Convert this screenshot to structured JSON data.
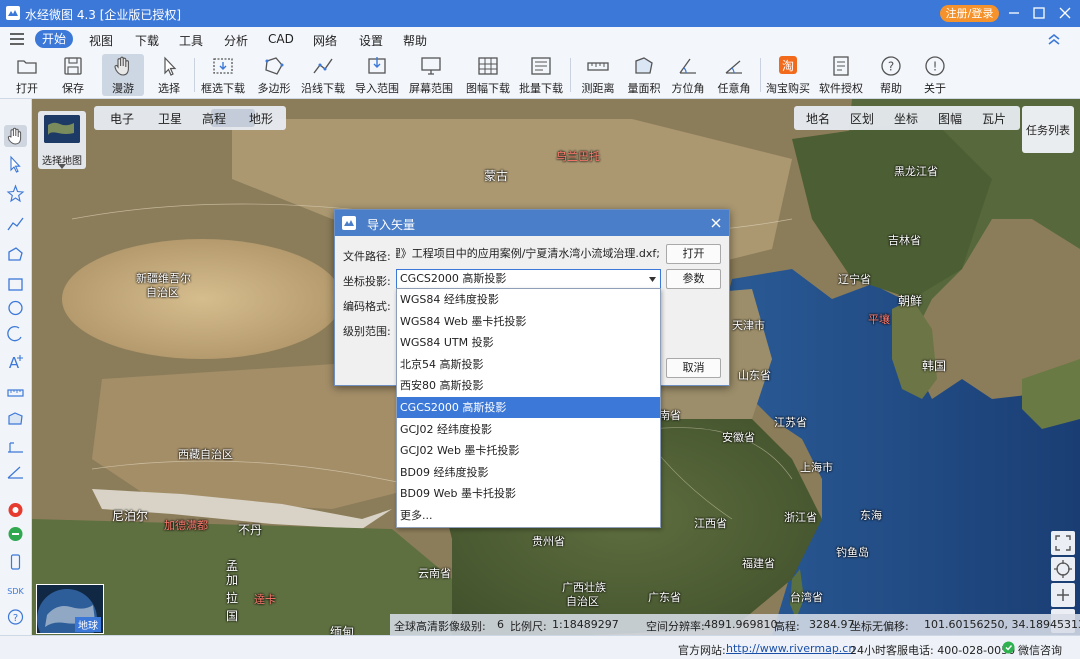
{
  "window": {
    "title": "水经微图 4.3 [企业版已授权]",
    "login_button": "注册/登录",
    "controls": [
      "minimize-icon",
      "restore-icon",
      "close-icon"
    ]
  },
  "menu": {
    "items": [
      "开始",
      "视图",
      "下载",
      "工具",
      "分析",
      "CAD",
      "网络",
      "设置",
      "帮助"
    ],
    "active": "开始"
  },
  "toolbar": {
    "items": [
      {
        "label": "打开",
        "icon": "folder-icon"
      },
      {
        "label": "保存",
        "icon": "save-icon"
      },
      {
        "label": "漫游",
        "icon": "hand-icon",
        "pressed": true
      },
      {
        "label": "选择",
        "icon": "cursor-icon"
      },
      {
        "label": "框选下载",
        "icon": "box-select-download-icon"
      },
      {
        "label": "多边形",
        "icon": "polygon-icon"
      },
      {
        "label": "沿线下载",
        "icon": "line-download-icon"
      },
      {
        "label": "导入范围",
        "icon": "import-range-icon"
      },
      {
        "label": "屏幕范围",
        "icon": "screen-range-icon"
      },
      {
        "label": "图幅下载",
        "icon": "sheet-download-icon"
      },
      {
        "label": "批量下载",
        "icon": "batch-download-icon"
      },
      {
        "label": "测距离",
        "icon": "ruler-icon"
      },
      {
        "label": "量面积",
        "icon": "area-icon"
      },
      {
        "label": "方位角",
        "icon": "azimuth-icon"
      },
      {
        "label": "任意角",
        "icon": "angle-icon"
      },
      {
        "label": "淘宝购买",
        "icon": "taobao-icon"
      },
      {
        "label": "软件授权",
        "icon": "license-icon"
      },
      {
        "label": "帮助",
        "icon": "help-icon"
      },
      {
        "label": "关于",
        "icon": "info-icon"
      }
    ]
  },
  "map": {
    "basemap_switch_label": "选择地图",
    "map_types": [
      "电子",
      "卫星",
      "高程",
      "地形"
    ],
    "active_map_type": "卫星",
    "overlays": [
      "地名",
      "区划",
      "坐标",
      "图幅",
      "瓦片"
    ],
    "task_list_label": "任务列表",
    "minimap_label": "地球",
    "labels": [
      {
        "text": "蒙古",
        "red": false
      },
      {
        "text": "乌兰巴托",
        "red": true
      },
      {
        "text": "黑龙江省",
        "red": false
      },
      {
        "text": "吉林省",
        "red": false
      },
      {
        "text": "辽宁省",
        "red": false
      },
      {
        "text": "朝鲜",
        "red": false
      },
      {
        "text": "平壤",
        "red": true
      },
      {
        "text": "韩国",
        "red": false
      },
      {
        "text": "新疆维吾尔",
        "red": false
      },
      {
        "text": "自治区",
        "red": false
      },
      {
        "text": "天津市",
        "red": false
      },
      {
        "text": "山东省",
        "red": false
      },
      {
        "text": "河南省",
        "red": false
      },
      {
        "text": "江苏省",
        "red": false
      },
      {
        "text": "安徽省",
        "red": false
      },
      {
        "text": "上海市",
        "red": false
      },
      {
        "text": "西藏自治区",
        "red": false
      },
      {
        "text": "尼泊尔",
        "red": false
      },
      {
        "text": "加德满都",
        "red": true
      },
      {
        "text": "不丹",
        "red": false
      },
      {
        "text": "孟",
        "red": false
      },
      {
        "text": "加",
        "red": false
      },
      {
        "text": "拉",
        "red": false
      },
      {
        "text": "国",
        "red": false
      },
      {
        "text": "達卡",
        "red": true
      },
      {
        "text": "贵州省",
        "red": false
      },
      {
        "text": "江西省",
        "red": false
      },
      {
        "text": "浙江省",
        "red": false
      },
      {
        "text": "福建省",
        "red": false
      },
      {
        "text": "云南省",
        "red": false
      },
      {
        "text": "广西壮族",
        "red": false
      },
      {
        "text": "自治区",
        "red": false
      },
      {
        "text": "广东省",
        "red": false
      },
      {
        "text": "台湾省",
        "red": false
      },
      {
        "text": "缅甸",
        "red": false
      },
      {
        "text": "东海",
        "red": false
      },
      {
        "text": "钓鱼岛",
        "red": false
      }
    ]
  },
  "status_bar": {
    "source": "全球高清影像",
    "level_label": "级别:",
    "level": "6",
    "scale_label": "比例尺:",
    "scale": "1:18489297",
    "resolution_label": "空间分辨率:",
    "resolution": "4891.969810",
    "elevation_label": "高程:",
    "elevation": "3284.97",
    "coord_label": "坐标无偏移:",
    "coords": "101.60156250, 34.18945313"
  },
  "footer": {
    "website_label": "官方网站:",
    "website": "http://www.rivermap.cn",
    "hotline": "24小时客服电话: 400-028-0050",
    "wechat": "微信咨询"
  },
  "dialog": {
    "title": "导入矢量",
    "file_path_label": "文件路径:",
    "file_path": "流域治理》工程项目中的应用案例/宁夏清水湾小流域治理.dxf;",
    "open_button": "打开",
    "projection_label": "坐标投影:",
    "projection_value": "CGCS2000 高斯投影",
    "params_button": "参数",
    "encoding_label": "编码格式:",
    "level_range_label": "级别范围:",
    "cancel_button": "取消"
  },
  "dropdown": {
    "options": [
      "WGS84 经纬度投影",
      "WGS84 Web 墨卡托投影",
      "WGS84 UTM 投影",
      "北京54 高斯投影",
      "西安80 高斯投影",
      "CGCS2000 高斯投影",
      "GCJ02 经纬度投影",
      "GCJ02 Web 墨卡托投影",
      "BD09 经纬度投影",
      "BD09 Web 墨卡托投影",
      "更多..."
    ],
    "selected": "CGCS2000 高斯投影"
  },
  "colors": {
    "accent": "#3c78d8",
    "login": "#f5922b",
    "taobao": "#f26b1d"
  }
}
